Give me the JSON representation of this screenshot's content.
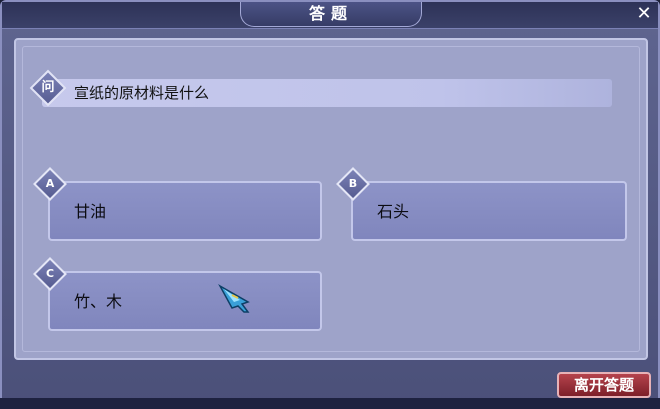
{
  "window": {
    "title": "答题",
    "close_glyph": "✕"
  },
  "question": {
    "badge": "问",
    "text": "宣纸的原材料是什么"
  },
  "options": [
    {
      "letter": "A",
      "text": "甘油"
    },
    {
      "letter": "B",
      "text": "石头"
    },
    {
      "letter": "C",
      "text": "竹、木"
    }
  ],
  "footer": {
    "leave_label": "离开答题"
  },
  "icons": {
    "close": "close-icon",
    "cursor": "feather-cursor-icon"
  },
  "colors": {
    "panel": "#9ea3c9",
    "option": "#868cc2",
    "leave_button": "#9a2f39"
  }
}
